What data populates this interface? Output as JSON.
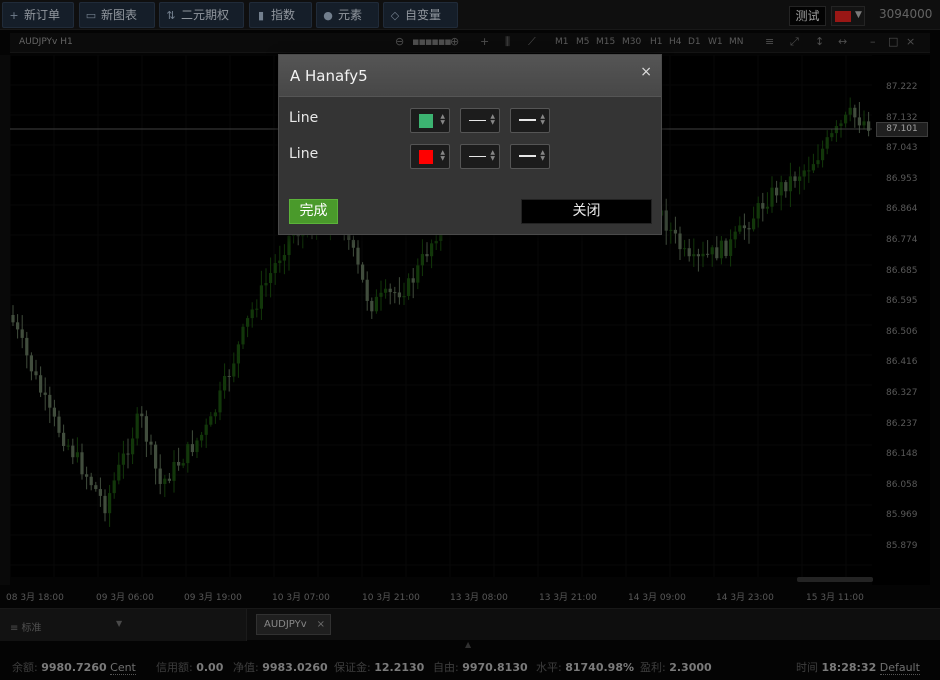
{
  "toolbar": {
    "buttons": [
      {
        "label": "新订单",
        "icon": "plus-icon"
      },
      {
        "label": "新图表",
        "icon": "chart-window-icon"
      },
      {
        "label": "二元期权",
        "icon": "binary-arrows-icon"
      },
      {
        "label": "指数",
        "icon": "indicator-bars-icon"
      },
      {
        "label": "元素",
        "icon": "shapes-icon"
      },
      {
        "label": "自变量",
        "icon": "diamond-icon"
      }
    ],
    "mode_label": "测试",
    "account_number": "3094000",
    "flag_colors": {
      "flag": "#d5201e"
    }
  },
  "chart": {
    "symbol_timeframe": "AUDJPYv H1",
    "timeframes": [
      "M1",
      "M5",
      "M15",
      "M30",
      "H1",
      "H4",
      "D1",
      "W1",
      "MN"
    ],
    "current_price": "87.101",
    "price_ticks": [
      "87.222",
      "87.132",
      "87.043",
      "86.953",
      "86.864",
      "86.774",
      "86.685",
      "86.595",
      "86.506",
      "86.416",
      "86.327",
      "86.237",
      "86.148",
      "86.058",
      "85.969",
      "85.879"
    ],
    "time_ticks": [
      "08 3月 18:00",
      "09 3月 06:00",
      "09 3月 19:00",
      "10 3月 07:00",
      "10 3月 21:00",
      "13 3月 08:00",
      "13 3月 21:00",
      "14 3月 09:00",
      "14 3月 23:00",
      "15 3月 11:00"
    ],
    "colors": {
      "up": "#1a4d0f",
      "down": "#5a6b55",
      "background": "#000000"
    }
  },
  "bottom": {
    "panel_label": "≡ 标准",
    "symbol_tab": "AUDJPYv",
    "tab_close": "×"
  },
  "status": {
    "balance_label": "余额:",
    "balance_value": "9980.7260",
    "balance_unit": "Cent",
    "credit_label": "信用额:",
    "credit_value": "0.00",
    "equity_label": "净值:",
    "equity_value": "9983.0260",
    "margin_label": "保证金:",
    "margin_value": "12.2130",
    "free_label": "自由:",
    "free_value": "9970.8130",
    "level_label": "水平:",
    "level_value": "81740.98%",
    "profit_label": "盈利:",
    "profit_value": "2.3000",
    "time_label": "时间",
    "time_value": "18:28:32",
    "time_zone": "Default"
  },
  "dialog": {
    "title": "A Hanafy5",
    "close_symbol": "×",
    "lines": [
      {
        "label": "Line",
        "color": "#3cb371"
      },
      {
        "label": "Line",
        "color": "#ff0000"
      }
    ],
    "done_label": "完成",
    "close_label": "关闭"
  }
}
